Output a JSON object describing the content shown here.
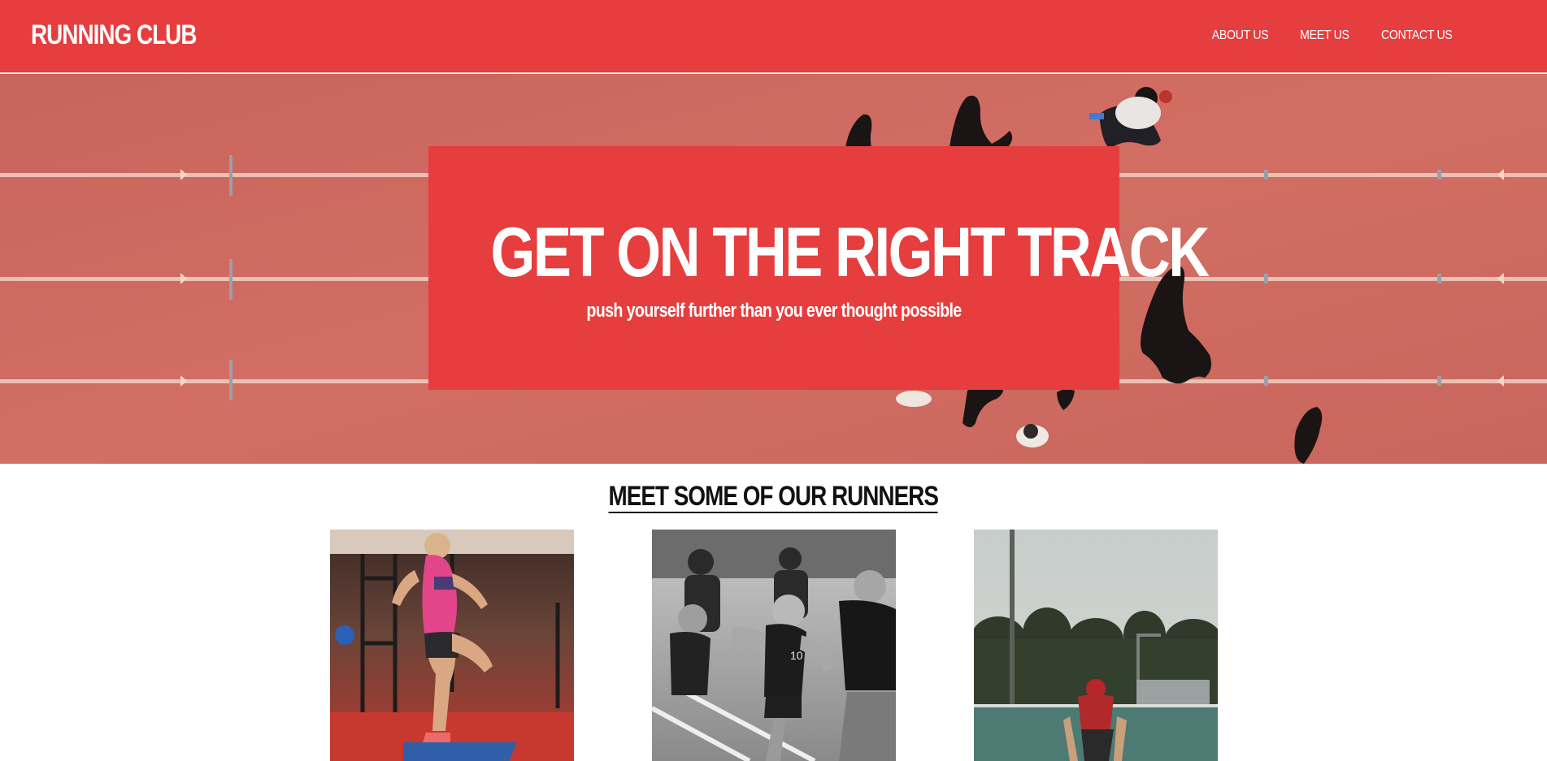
{
  "header": {
    "logo": "RUNNING CLUB",
    "nav": [
      {
        "label": "ABOUT US"
      },
      {
        "label": "MEET US"
      },
      {
        "label": "CONTACT US"
      }
    ]
  },
  "hero": {
    "title": "GET ON THE RIGHT TRACK",
    "subtitle": "push yourself further than you ever thought possible"
  },
  "runners": {
    "title": "MEET SOME OF OUR RUNNERS"
  },
  "colors": {
    "brand_red": "#e63d3e",
    "track": "#cf6a60",
    "text_dark": "#111111"
  }
}
